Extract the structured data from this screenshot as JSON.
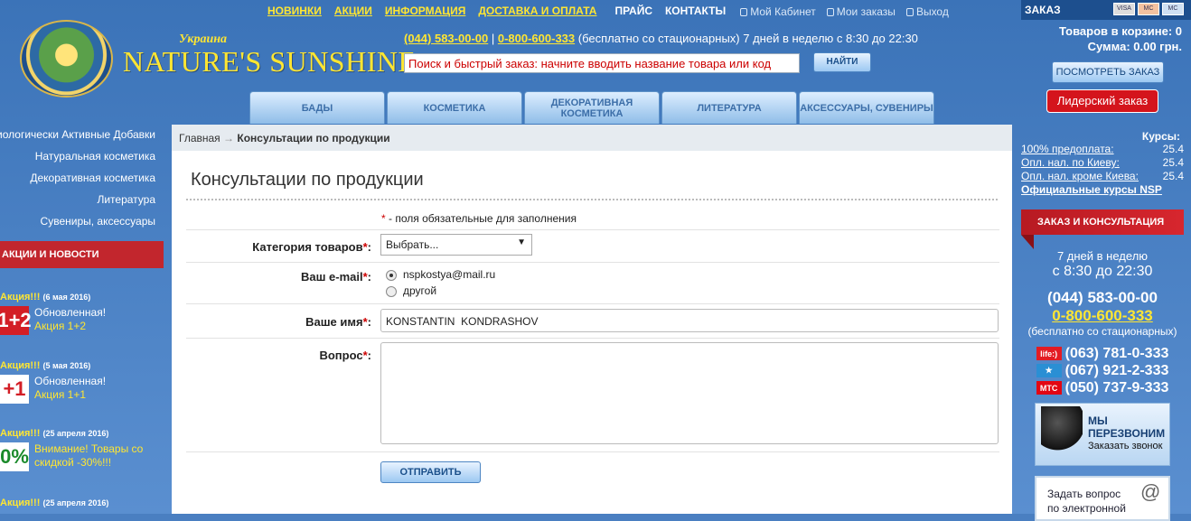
{
  "top_nav": {
    "items": [
      "НОВИНКИ",
      "АКЦИИ",
      "ИНФОРМАЦИЯ",
      "ДОСТАВКА И ОПЛАТА"
    ],
    "price": "ПРАЙС",
    "contacts": "КОНТАКТЫ",
    "cabinet": "Мой Кабинет",
    "orders": "Мои заказы",
    "logout": "Выход"
  },
  "header": {
    "country": "Украина",
    "brand": "NATURE'S SUNSHINE",
    "phone1": "(044) 583-00-00",
    "phone2": "0-800-600-333",
    "phone_note": "(бесплатно со стационарных) 7 дней в неделю с 8:30 до 22:30",
    "search_placeholder": "Поиск и быстрый заказ: начните вводить название товара или код",
    "search_button": "НАЙТИ"
  },
  "tabs": [
    "БАДЫ",
    "КОСМЕТИКА",
    "ДЕКОРАТИВНАЯ КОСМЕТИКА",
    "ЛИТЕРАТУРА",
    "АКСЕССУАРЫ, СУВЕНИРЫ"
  ],
  "order_panel": {
    "title": "ЗАКАЗ",
    "cards": [
      "VISA",
      "MC",
      "MC"
    ],
    "items_in_cart": "Товаров в корзине: 0",
    "total": "Сумма: 0.00 грн.",
    "view_order": "ПОСМОТРЕТЬ ЗАКАЗ",
    "leader_order": "Лидерский заказ"
  },
  "courses": {
    "title": "Курсы:",
    "rows": [
      {
        "label": "100% предоплата:",
        "value": "25.4"
      },
      {
        "label": "Опл. нал. по Киеву:",
        "value": "25.4"
      },
      {
        "label": "Опл. нал. кроме Киева:",
        "value": "25.4"
      }
    ],
    "official": "Официальные курсы NSP"
  },
  "consult_panel": {
    "title": "ЗАКАЗ И КОНСУЛЬТАЦИЯ",
    "days": "7 дней в неделю",
    "time": "с 8:30 до 22:30",
    "phone1": "(044) 583-00-00",
    "phone2": "0-800-600-333",
    "phone2_note": "(бесплатно со стационарных)",
    "mobiles": [
      {
        "op": "life:)",
        "num": "(063) 781-0-333",
        "color": "#e31b23"
      },
      {
        "op": "★",
        "num": "(067) 921-2-333",
        "color": "#2a8fd4"
      },
      {
        "op": "МТС",
        "num": "(050) 737-9-333",
        "color": "#e30613"
      }
    ],
    "callback_line1": "МЫ",
    "callback_line2": "ПЕРЕЗВОНИМ",
    "callback_sub": "Заказать звонок",
    "ask_line1": "Задать вопрос",
    "ask_line2": "по электронной"
  },
  "left_nav": [
    "Биологически Активные Добавки",
    "Натуральная косметика",
    "Декоративная косметика",
    "Литература",
    "Сувениры, аксессуары"
  ],
  "news_header": "АКЦИИ И НОВОСТИ",
  "news": [
    {
      "title": "Акция!!!",
      "date": "(6 мая 2016)",
      "thumb": "1+2",
      "line1": "Обновленная!",
      "line2": "Акция 1+2"
    },
    {
      "title": "Акция!!!",
      "date": "(5 мая 2016)",
      "thumb": "+1",
      "line1": "Обновленная!",
      "line2": "Акция 1+1"
    },
    {
      "title": "Акция!!!",
      "date": "(25 апреля 2016)",
      "thumb": "0%",
      "line1": "Внимание! Товары со",
      "line2": "скидкой -30%!!!"
    },
    {
      "title": "Акция!!!",
      "date": "(25 апреля 2016)"
    }
  ],
  "breadcrumb": {
    "home": "Главная",
    "sep": "→",
    "current": "Консультации по продукции"
  },
  "form": {
    "title": "Консультации по продукции",
    "required_star": "*",
    "required_note": " - поля обязательные для заполнения",
    "category_label": "Категория товаров",
    "category_value": "Выбрать...",
    "email_label": "Ваш e-mail",
    "email_option1": "nspkostya@mail.ru",
    "email_option2": "другой",
    "name_label": "Ваше имя",
    "name_value": "KONSTANTIN  KONDRASHOV",
    "question_label": "Вопрос",
    "question_value": "",
    "submit": "ОТПРАВИТЬ"
  }
}
